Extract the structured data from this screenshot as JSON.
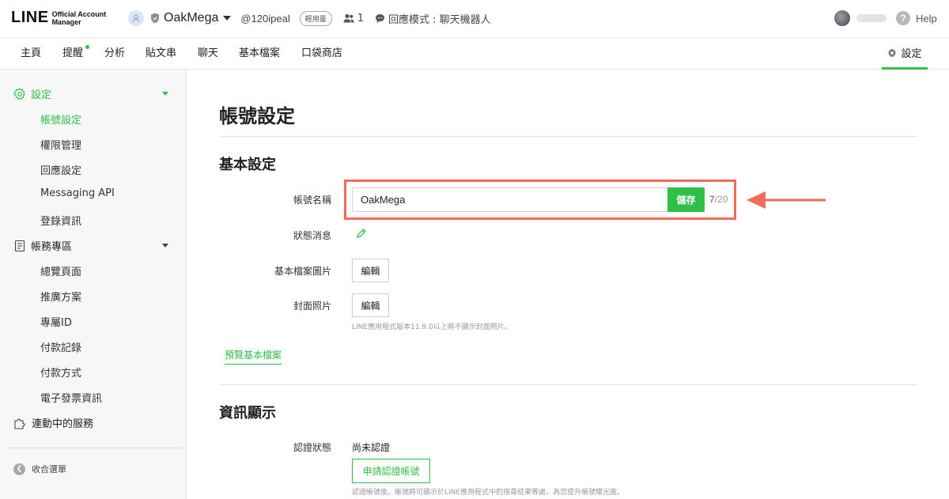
{
  "header": {
    "logo_main": "LINE",
    "logo_sub_1": "Official Account",
    "logo_sub_2": "Manager",
    "account_name": "OakMega",
    "account_id": "@120ipeal",
    "plan_badge": "輕用量",
    "friends_count": "1",
    "mode_label": "回應模式 : 聊天機器人",
    "help_label": "Help"
  },
  "nav": {
    "items": [
      "主頁",
      "提醒",
      "分析",
      "貼文串",
      "聊天",
      "基本檔案",
      "口袋商店"
    ],
    "settings_label": "設定",
    "accent_color": "#2ec047"
  },
  "sidebar": {
    "settings_group": "設定",
    "settings_items": [
      "帳號設定",
      "權限管理",
      "回應設定",
      "Messaging API",
      "登錄資訊"
    ],
    "billing_group": "帳務專區",
    "billing_items": [
      "總覽頁面",
      "推廣方案",
      "專屬ID",
      "付款記錄",
      "付款方式",
      "電子發票資訊"
    ],
    "services_group": "連動中的服務",
    "collapse_label": "收合選單"
  },
  "main": {
    "page_title": "帳號設定",
    "basic_section": "基本設定",
    "account_name_label": "帳號名稱",
    "account_name_value": "OakMega",
    "save_label": "儲存",
    "char_count": "7",
    "char_max": "/20",
    "status_label": "狀態消息",
    "profile_image_label": "基本檔案圖片",
    "edit_label": "編輯",
    "cover_label": "封面照片",
    "cover_hint": "LINE應用程式版本11.9.0以上將不顯示封面照片。",
    "preview_link": "預覽基本檔案",
    "info_section": "資訊顯示",
    "verify_label": "認證狀態",
    "verify_value": "尚未認證",
    "apply_label": "申請認證帳號",
    "verify_hint": "認證帳號後，帳號將可顯示於LINE應用程式中的搜尋結果等處，為您提升帳號曝光度。"
  },
  "annotation": {
    "highlight_color": "#f26b5b"
  }
}
